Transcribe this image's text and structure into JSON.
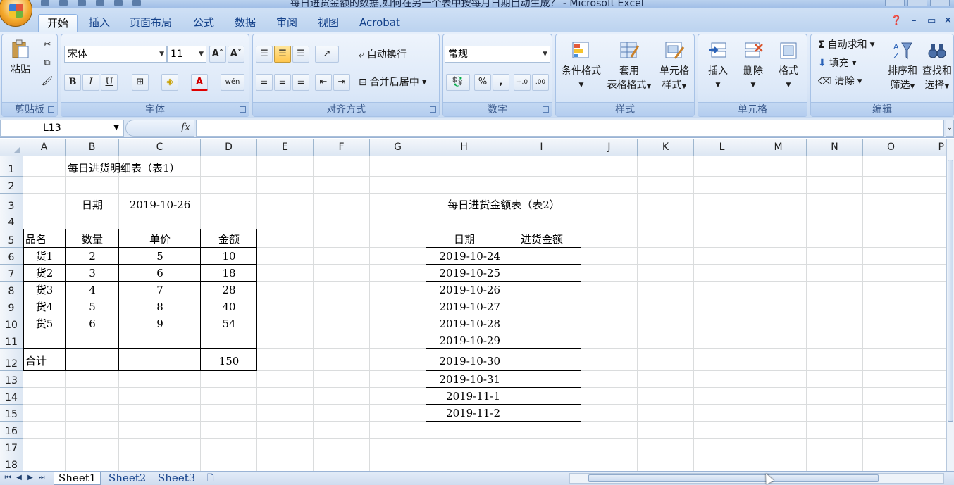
{
  "window": {
    "title": "每日进货金额的数据,如何在另一个表中按每月日期自动生成？ - Microsoft Excel"
  },
  "ribbon": {
    "tabs": [
      "开始",
      "插入",
      "页面布局",
      "公式",
      "数据",
      "审阅",
      "视图",
      "Acrobat"
    ],
    "active_tab": "开始",
    "clipboard": {
      "label": "剪贴板",
      "paste": "粘贴"
    },
    "font": {
      "label": "字体",
      "name": "宋体",
      "size": "11",
      "bold": "B",
      "italic": "I",
      "underline": "U",
      "grow": "A˄",
      "shrink": "A˅",
      "font_color": "A",
      "phonetic": "wén"
    },
    "alignment": {
      "label": "对齐方式",
      "wrap": "自动换行",
      "merge": "合并后居中"
    },
    "number": {
      "label": "数字",
      "format": "常规",
      "percent": "%",
      "comma": ","
    },
    "styles": {
      "label": "样式",
      "conditional": "条件格式",
      "table_format_1": "套用",
      "table_format_2": "表格格式",
      "cell_style_1": "单元格",
      "cell_style_2": "样式"
    },
    "cells": {
      "label": "单元格",
      "insert": "插入",
      "delete": "删除",
      "format": "格式"
    },
    "editing": {
      "label": "编辑",
      "autosum": "自动求和",
      "fill": "填充",
      "clear": "清除",
      "sort_1": "排序和",
      "sort_2": "筛选",
      "find_1": "查找和",
      "find_2": "选择"
    }
  },
  "formula_bar": {
    "name_box": "L13",
    "fx": "fx",
    "content": ""
  },
  "sheet": {
    "columns": [
      "A",
      "B",
      "C",
      "D",
      "E",
      "F",
      "G",
      "H",
      "I",
      "J",
      "K",
      "L",
      "M",
      "N",
      "O",
      "P"
    ],
    "rows": [
      "1",
      "2",
      "3",
      "4",
      "5",
      "6",
      "7",
      "8",
      "9",
      "10",
      "11",
      "12",
      "13",
      "14",
      "15",
      "16",
      "17",
      "18"
    ],
    "table1": {
      "title": "每日进货明细表（表1）",
      "date_label": "日期",
      "date_value": "2019-10-26",
      "headers": [
        "品名",
        "数量",
        "单价",
        "金额"
      ],
      "rows": [
        [
          "货1",
          "2",
          "5",
          "10"
        ],
        [
          "货2",
          "3",
          "6",
          "18"
        ],
        [
          "货3",
          "4",
          "7",
          "28"
        ],
        [
          "货4",
          "5",
          "8",
          "40"
        ],
        [
          "货5",
          "6",
          "9",
          "54"
        ]
      ],
      "total_label": "合计",
      "total_value": "150"
    },
    "table2": {
      "title": "每日进货金额表（表2）",
      "headers": [
        "日期",
        "进货金额"
      ],
      "dates": [
        "2019-10-24",
        "2019-10-25",
        "2019-10-26",
        "2019-10-27",
        "2019-10-28",
        "2019-10-29",
        "2019-10-30",
        "2019-10-31",
        "2019-11-1",
        "2019-11-2"
      ]
    }
  },
  "sheet_tabs": [
    "Sheet1",
    "Sheet2",
    "Sheet3"
  ],
  "active_sheet": "Sheet1"
}
